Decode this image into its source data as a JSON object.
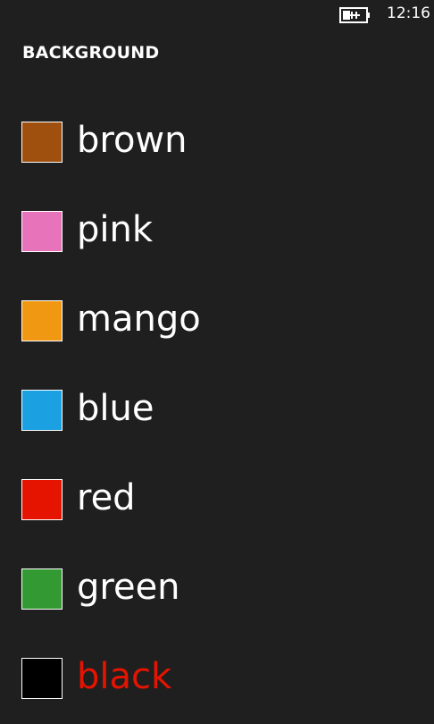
{
  "status_bar": {
    "time": "12:16",
    "battery_icon": "battery-charging-icon"
  },
  "page": {
    "title": "BACKGROUND"
  },
  "colors": [
    {
      "label": "brown",
      "swatch": "#a0500e",
      "selected": false
    },
    {
      "label": "pink",
      "swatch": "#e774bb",
      "selected": false
    },
    {
      "label": "mango",
      "swatch": "#f09812",
      "selected": false
    },
    {
      "label": "blue",
      "swatch": "#1ba1e2",
      "selected": false
    },
    {
      "label": "red",
      "swatch": "#e51400",
      "selected": false
    },
    {
      "label": "green",
      "swatch": "#339933",
      "selected": false
    },
    {
      "label": "black",
      "swatch": "#000000",
      "selected": true
    }
  ],
  "theme": {
    "background": "#1f1f1f",
    "text": "#ffffff",
    "accent_selected": "#e51400"
  }
}
